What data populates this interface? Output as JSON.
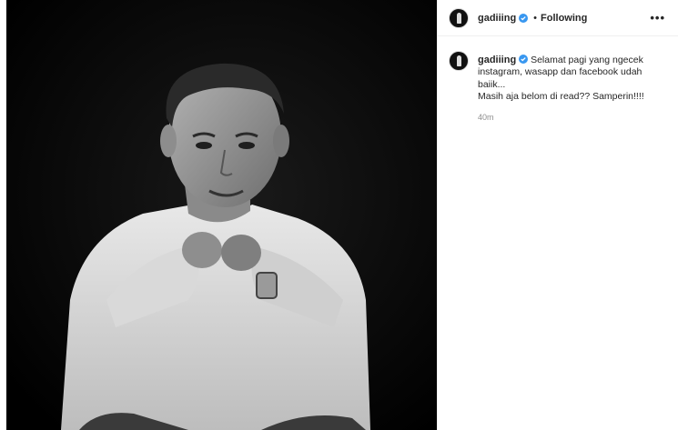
{
  "post": {
    "username": "gadiiing",
    "follow_status": "Following",
    "more_icon": "•••",
    "caption_first": "Selamat pagi yang ngecek",
    "caption_lines": [
      "instagram, wasapp dan facebook udah",
      "baiik...",
      "Masih aja belom di read?? Samperin!!!!"
    ],
    "time": "40m",
    "verified_color": "#3897f0"
  }
}
